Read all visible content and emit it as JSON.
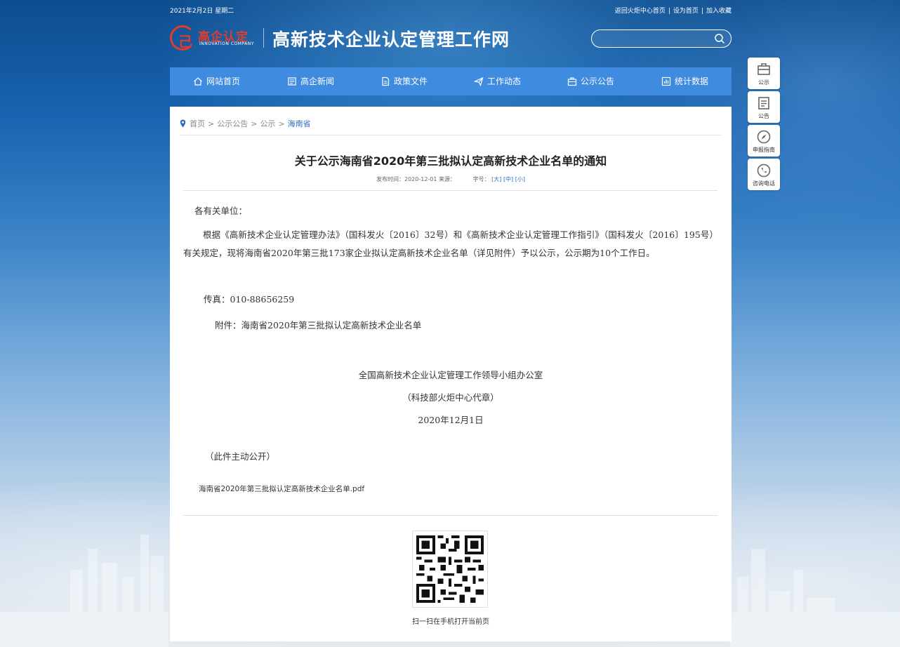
{
  "top": {
    "date": "2021年2月2日 星期二",
    "links": [
      "返回火炬中心首页",
      "设为首页",
      "加入收藏"
    ],
    "separator": "|"
  },
  "logo": {
    "brand": "高企认定",
    "brand_sub": "INNOVATION COMPANY",
    "site_title": "高新技术企业认定管理工作网"
  },
  "search": {
    "placeholder": ""
  },
  "nav": [
    {
      "label": "网站首页",
      "icon": "home-icon"
    },
    {
      "label": "高企新闻",
      "icon": "news-icon"
    },
    {
      "label": "政策文件",
      "icon": "document-icon"
    },
    {
      "label": "工作动态",
      "icon": "paper-plane-icon"
    },
    {
      "label": "公示公告",
      "icon": "briefcase-icon"
    },
    {
      "label": "统计数据",
      "icon": "chart-icon"
    }
  ],
  "side": [
    {
      "label": "公示",
      "icon": "notice-board-icon"
    },
    {
      "label": "公告",
      "icon": "announcement-icon"
    },
    {
      "label": "申报指南",
      "icon": "compass-icon"
    },
    {
      "label": "咨询电话",
      "icon": "phone-icon"
    }
  ],
  "breadcrumb": {
    "items": [
      "首页",
      "公示公告",
      "公示"
    ],
    "current": "海南省",
    "sep": ">"
  },
  "article": {
    "title": "关于公示海南省2020年第三批拟认定高新技术企业名单的通知",
    "meta_time": "发布时间：2020-12-01 来源：",
    "font_label": "字号：",
    "font_sizes": [
      "[大]",
      "[中]",
      "[小]"
    ],
    "salutation": "各有关单位：",
    "main": "根据《高新技术企业认定管理办法》（国科发火〔2016〕32号）和《高新技术企业认定管理工作指引》（国科发火〔2016〕195号）有关规定，现将海南省2020年第三批173家企业拟认定高新技术企业名单（详见附件）予以公示，公示期为10个工作日。",
    "fax": "传真：010-88656259",
    "attachment": "附件：海南省2020年第三批拟认定高新技术企业名单",
    "org": "全国高新技术企业认定管理工作领导小组办公室",
    "seal": "（科技部火炬中心代章）",
    "date": "2020年12月1日",
    "public_note": "（此件主动公开）",
    "file": "海南省2020年第三批拟认定高新技术企业名单.pdf"
  },
  "qr": {
    "caption": "扫一扫在手机打开当前页"
  }
}
